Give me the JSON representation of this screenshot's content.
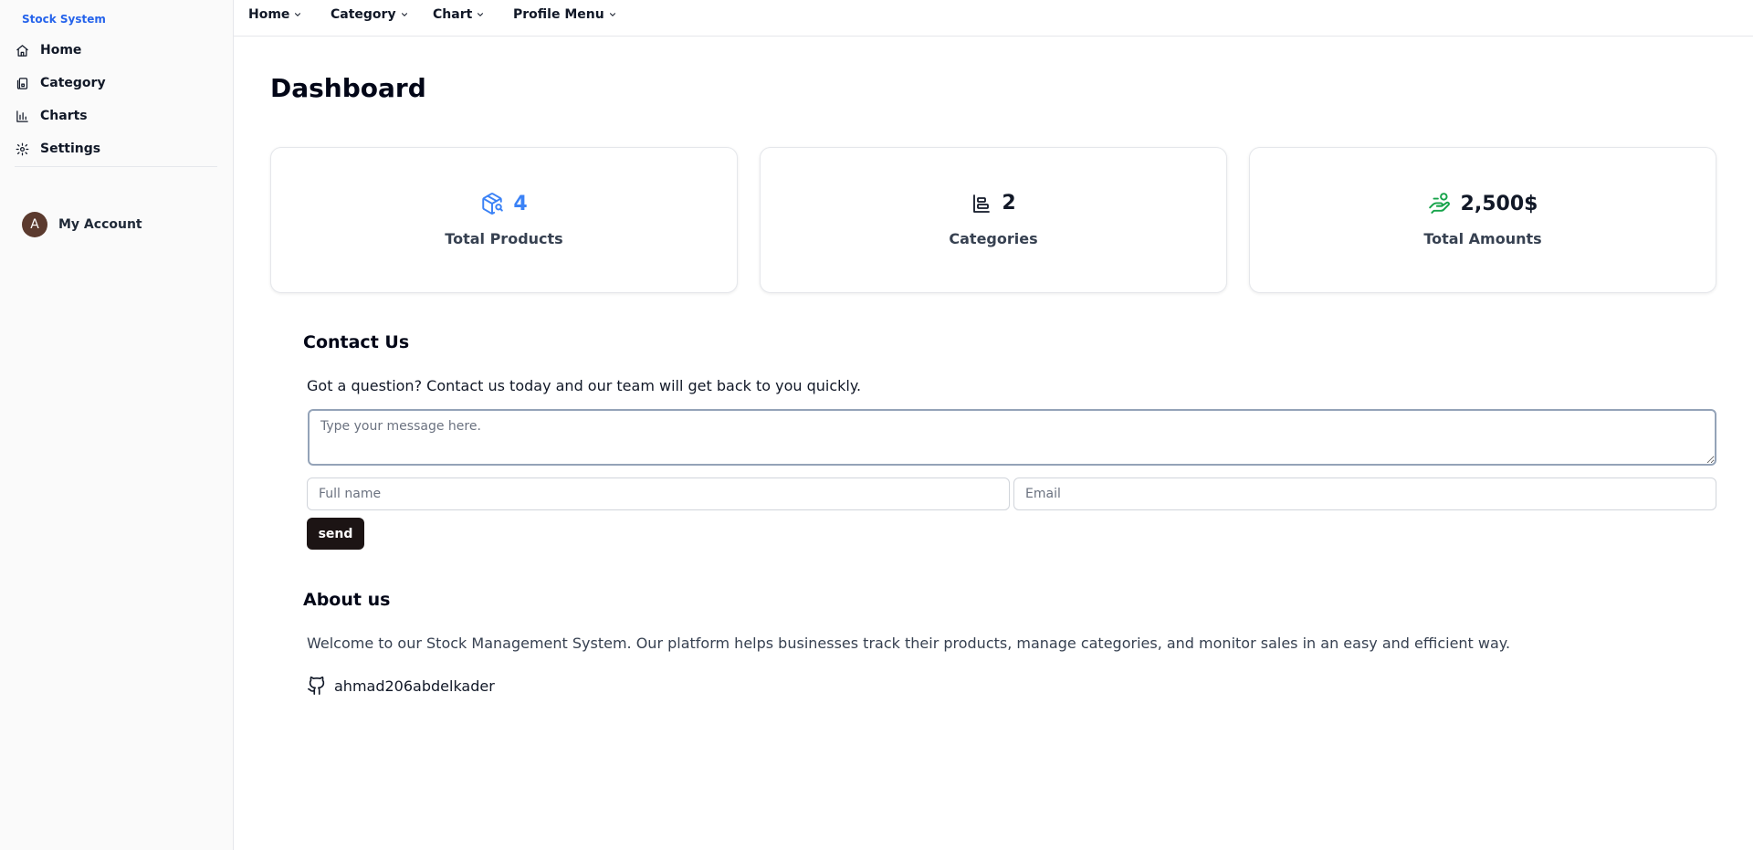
{
  "sidebar": {
    "brand": "Stock System",
    "items": [
      {
        "label": "Home",
        "icon": "home-icon"
      },
      {
        "label": "Category",
        "icon": "category-icon"
      },
      {
        "label": "Charts",
        "icon": "bar-chart-icon"
      },
      {
        "label": "Settings",
        "icon": "gear-icon"
      }
    ],
    "account": {
      "avatar_letter": "A",
      "label": "My Account"
    }
  },
  "topnav": {
    "items": [
      {
        "label": "Home"
      },
      {
        "label": "Category"
      },
      {
        "label": "Chart"
      },
      {
        "label": "Profile Menu"
      }
    ]
  },
  "main": {
    "title": "Dashboard",
    "cards": [
      {
        "value": "4",
        "caption": "Total Products",
        "icon": "package-search-icon",
        "color": "#3b82f6"
      },
      {
        "value": "2",
        "caption": "Categories",
        "icon": "category-list-icon",
        "color": "#111827"
      },
      {
        "value": "2,500$",
        "caption": "Total Amounts",
        "icon": "money-hand-icon",
        "color": "#16a34a"
      }
    ],
    "contact": {
      "heading": "Contact Us",
      "text": "Got a question? Contact us today and our team will get back to you quickly.",
      "message_placeholder": "Type your message here.",
      "name_placeholder": "Full name",
      "email_placeholder": "Email",
      "send_label": "send"
    },
    "about": {
      "heading": "About us",
      "text": "Welcome to our Stock Management System. Our platform helps businesses track their products, manage categories, and monitor sales in an easy and efficient way.",
      "github_user": "ahmad206abdelkader"
    }
  }
}
